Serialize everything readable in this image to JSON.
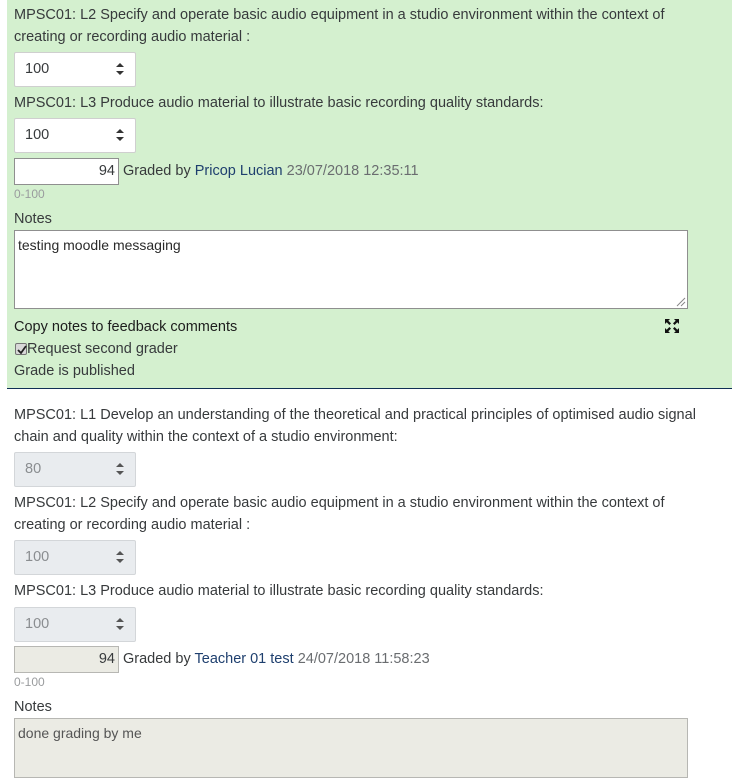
{
  "top": {
    "criterion_l2_label": "MPSC01: L2 Specify and operate basic audio equipment in a studio environment within the context of creating or recording audio material :",
    "criterion_l2_value": "100",
    "criterion_l3_label": "MPSC01: L3 Produce audio material to illustrate basic recording quality standards:",
    "criterion_l3_value": "100",
    "grade_value": "94",
    "graded_by_prefix": "Graded by",
    "grader_name": "Pricop Lucian",
    "graded_timestamp": "23/07/2018 12:35:11",
    "grade_range": "0-100",
    "notes_label": "Notes",
    "notes_text": "testing moodle messaging",
    "copy_notes_label": "Copy notes to feedback comments",
    "second_grader_label": "Request second grader",
    "second_grader_checked": true,
    "published_text": "Grade is published"
  },
  "bottom": {
    "criterion_l1_label": "MPSC01: L1 Develop an understanding of the theoretical and practical principles of optimised audio signal chain and quality within the context of a studio environment:",
    "criterion_l1_value": "80",
    "criterion_l2_label": "MPSC01: L2 Specify and operate basic audio equipment in a studio environment within the context of creating or recording audio material :",
    "criterion_l2_value": "100",
    "criterion_l3_label": "MPSC01: L3 Produce audio material to illustrate basic recording quality standards:",
    "criterion_l3_value": "100",
    "grade_value": "94",
    "graded_by_prefix": "Graded by",
    "grader_name": "Teacher 01 test",
    "graded_timestamp": "24/07/2018 11:58:23",
    "grade_range": "0-100",
    "notes_label": "Notes",
    "notes_text": "done grading by me"
  },
  "icons": {
    "select_caret": "up-down-caret-icon",
    "expand": "expand-arrows-icon",
    "checkbox": "checkmark-icon"
  },
  "colors": {
    "panel_green": "#d4f0cf",
    "link_blue": "#1e3f6e",
    "divider": "#0f2f55",
    "disabled_field": "#e9ecef"
  }
}
